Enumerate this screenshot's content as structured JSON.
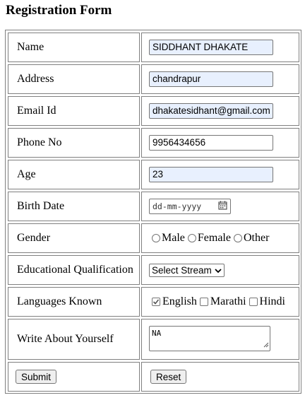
{
  "form": {
    "title": "Registration Form"
  },
  "fields": {
    "name": {
      "label": "Name",
      "value": "SIDDHANT DHAKATE"
    },
    "address": {
      "label": "Address",
      "value": "chandrapur"
    },
    "email": {
      "label": "Email Id",
      "value": "dhakatesidhant@gmail.com"
    },
    "phone": {
      "label": "Phone No",
      "value": "9956434656"
    },
    "age": {
      "label": "Age",
      "value": "23"
    },
    "birth_date": {
      "label": "Birth Date",
      "placeholder": "dd-mm-yyyy",
      "icon": "calendar-icon"
    },
    "gender": {
      "label": "Gender",
      "options": [
        "Male",
        "Female",
        "Other"
      ],
      "selected": ""
    },
    "qualification": {
      "label": "Educational Qualification",
      "selected": "Select Stream",
      "icon": "chevron-down-icon"
    },
    "languages": {
      "label": "Languages Known",
      "options": [
        "English",
        "Marathi",
        "Hindi"
      ],
      "checked": [
        "English"
      ]
    },
    "about": {
      "label": "Write About Yourself",
      "value": "NA"
    }
  },
  "buttons": {
    "submit": "Submit",
    "reset": "Reset"
  }
}
